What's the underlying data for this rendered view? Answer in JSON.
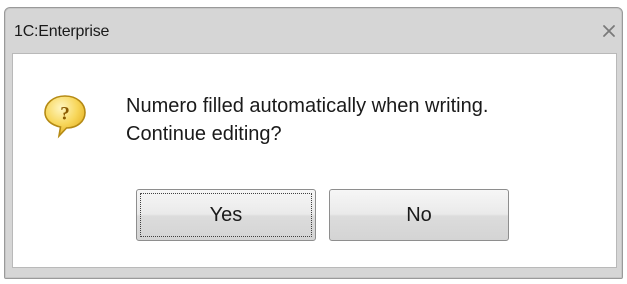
{
  "dialog": {
    "title": "1C:Enterprise",
    "close_icon": "close-icon",
    "icon": "question-balloon-icon",
    "message_line1": "Numero filled automatically when writing.",
    "message_line2": "Continue editing?",
    "buttons": {
      "yes_label": "Yes",
      "no_label": "No"
    },
    "colors": {
      "frame": "#d6d6d6",
      "client": "#ffffff",
      "icon_fill": "#f5d24a",
      "icon_outline": "#b58a14"
    }
  }
}
